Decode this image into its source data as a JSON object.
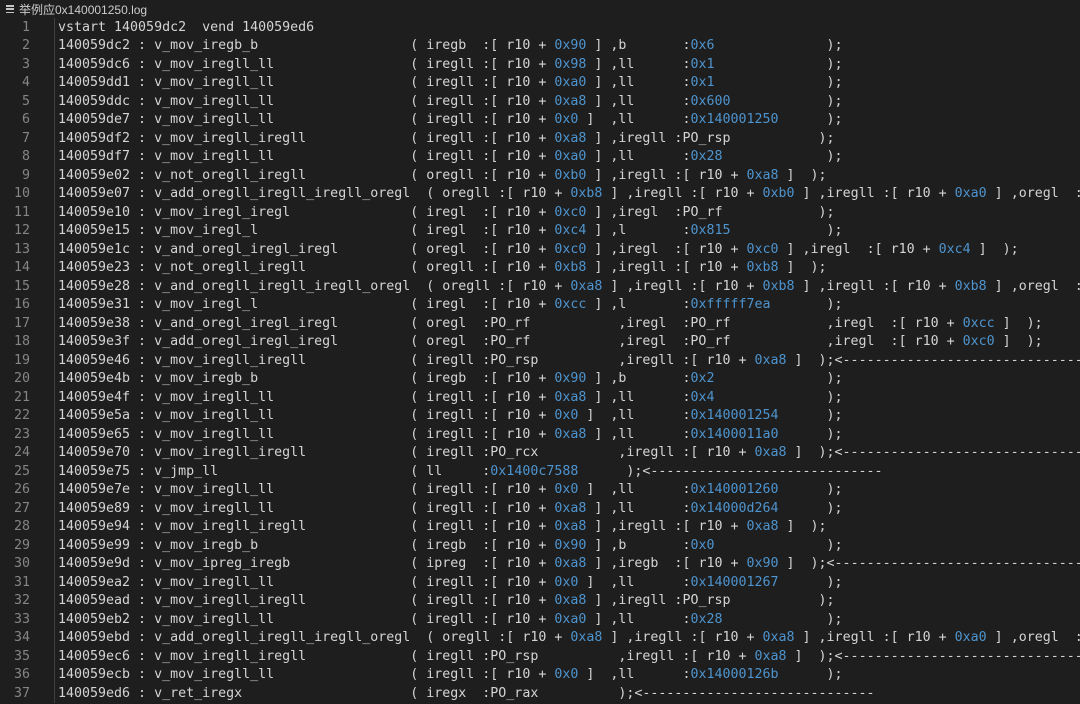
{
  "tab": {
    "title": "举例应0x140001250.log"
  },
  "lines": [
    [
      {
        "t": "vstart 140059dc2  vend 140059ed6"
      }
    ],
    [
      {
        "t": "140059dc2 : v_mov_iregb_b                   ( iregb  :[ r10 + "
      },
      {
        "t": "0x90",
        "h": 1
      },
      {
        "t": " ] ,b       :"
      },
      {
        "t": "0x6",
        "h": 1
      },
      {
        "t": "              );"
      }
    ],
    [
      {
        "t": "140059dc6 : v_mov_iregll_ll                 ( iregll :[ r10 + "
      },
      {
        "t": "0x98",
        "h": 1
      },
      {
        "t": " ] ,ll      :"
      },
      {
        "t": "0x1",
        "h": 1
      },
      {
        "t": "              );"
      }
    ],
    [
      {
        "t": "140059dd1 : v_mov_iregll_ll                 ( iregll :[ r10 + "
      },
      {
        "t": "0xa0",
        "h": 1
      },
      {
        "t": " ] ,ll      :"
      },
      {
        "t": "0x1",
        "h": 1
      },
      {
        "t": "              );"
      }
    ],
    [
      {
        "t": "140059ddc : v_mov_iregll_ll                 ( iregll :[ r10 + "
      },
      {
        "t": "0xa8",
        "h": 1
      },
      {
        "t": " ] ,ll      :"
      },
      {
        "t": "0x600",
        "h": 1
      },
      {
        "t": "            );"
      }
    ],
    [
      {
        "t": "140059de7 : v_mov_iregll_ll                 ( iregll :[ r10 + "
      },
      {
        "t": "0x0",
        "h": 1
      },
      {
        "t": " ]  ,ll      :"
      },
      {
        "t": "0x140001250",
        "h": 1
      },
      {
        "t": "      );"
      }
    ],
    [
      {
        "t": "140059df2 : v_mov_iregll_iregll             ( iregll :[ r10 + "
      },
      {
        "t": "0xa8",
        "h": 1
      },
      {
        "t": " ] ,iregll :PO_rsp           );"
      }
    ],
    [
      {
        "t": "140059df7 : v_mov_iregll_ll                 ( iregll :[ r10 + "
      },
      {
        "t": "0xa0",
        "h": 1
      },
      {
        "t": " ] ,ll      :"
      },
      {
        "t": "0x28",
        "h": 1
      },
      {
        "t": "             );"
      }
    ],
    [
      {
        "t": "140059e02 : v_not_oregll_iregll             ( oregll :[ r10 + "
      },
      {
        "t": "0xb0",
        "h": 1
      },
      {
        "t": " ] ,iregll :[ r10 + "
      },
      {
        "t": "0xa8",
        "h": 1
      },
      {
        "t": " ]  );"
      }
    ],
    [
      {
        "t": "140059e07 : v_add_oregll_iregll_iregll_oregl  ( oregll :[ r10 + "
      },
      {
        "t": "0xb8",
        "h": 1
      },
      {
        "t": " ] ,iregll :[ r10 + "
      },
      {
        "t": "0xb0",
        "h": 1
      },
      {
        "t": " ] ,iregll :[ r10 + "
      },
      {
        "t": "0xa0",
        "h": 1
      },
      {
        "t": " ] ,oregl  :PO_rf"
      }
    ],
    [
      {
        "t": "140059e10 : v_mov_iregl_iregl               ( iregl  :[ r10 + "
      },
      {
        "t": "0xc0",
        "h": 1
      },
      {
        "t": " ] ,iregl  :PO_rf            );"
      }
    ],
    [
      {
        "t": "140059e15 : v_mov_iregl_l                   ( iregl  :[ r10 + "
      },
      {
        "t": "0xc4",
        "h": 1
      },
      {
        "t": " ] ,l       :"
      },
      {
        "t": "0x815",
        "h": 1
      },
      {
        "t": "            );"
      }
    ],
    [
      {
        "t": "140059e1c : v_and_oregl_iregl_iregl         ( oregl  :[ r10 + "
      },
      {
        "t": "0xc0",
        "h": 1
      },
      {
        "t": " ] ,iregl  :[ r10 + "
      },
      {
        "t": "0xc0",
        "h": 1
      },
      {
        "t": " ] ,iregl  :[ r10 + "
      },
      {
        "t": "0xc4",
        "h": 1
      },
      {
        "t": " ]  );"
      }
    ],
    [
      {
        "t": "140059e23 : v_not_oregll_iregll             ( oregll :[ r10 + "
      },
      {
        "t": "0xb8",
        "h": 1
      },
      {
        "t": " ] ,iregll :[ r10 + "
      },
      {
        "t": "0xb8",
        "h": 1
      },
      {
        "t": " ]  );"
      }
    ],
    [
      {
        "t": "140059e28 : v_and_oregll_iregll_iregll_oregl  ( oregll :[ r10 + "
      },
      {
        "t": "0xa8",
        "h": 1
      },
      {
        "t": " ] ,iregll :[ r10 + "
      },
      {
        "t": "0xb8",
        "h": 1
      },
      {
        "t": " ] ,iregll :[ r10 + "
      },
      {
        "t": "0xb8",
        "h": 1
      },
      {
        "t": " ] ,oregl  :PO_rf"
      }
    ],
    [
      {
        "t": "140059e31 : v_mov_iregl_l                   ( iregl  :[ r10 + "
      },
      {
        "t": "0xcc",
        "h": 1
      },
      {
        "t": " ] ,l       :"
      },
      {
        "t": "0xfffff7ea",
        "h": 1
      },
      {
        "t": "       );"
      }
    ],
    [
      {
        "t": "140059e38 : v_and_oregl_iregl_iregl         ( oregl  :PO_rf           ,iregl  :PO_rf            ,iregl  :[ r10 + "
      },
      {
        "t": "0xcc",
        "h": 1
      },
      {
        "t": " ]  );"
      }
    ],
    [
      {
        "t": "140059e3f : v_add_oregl_iregl_iregl         ( oregl  :PO_rf           ,iregl  :PO_rf            ,iregl  :[ r10 + "
      },
      {
        "t": "0xc0",
        "h": 1
      },
      {
        "t": " ]  );"
      }
    ],
    [
      {
        "t": "140059e46 : v_mov_iregll_iregll             ( iregll :PO_rsp          ,iregll :[ r10 + "
      },
      {
        "t": "0xa8",
        "h": 1
      },
      {
        "t": " ]  );<---------------------------------"
      }
    ],
    [
      {
        "t": "140059e4b : v_mov_iregb_b                   ( iregb  :[ r10 + "
      },
      {
        "t": "0x90",
        "h": 1
      },
      {
        "t": " ] ,b       :"
      },
      {
        "t": "0x2",
        "h": 1
      },
      {
        "t": "              );"
      }
    ],
    [
      {
        "t": "140059e4f : v_mov_iregll_ll                 ( iregll :[ r10 + "
      },
      {
        "t": "0xa8",
        "h": 1
      },
      {
        "t": " ] ,ll      :"
      },
      {
        "t": "0x4",
        "h": 1
      },
      {
        "t": "              );"
      }
    ],
    [
      {
        "t": "140059e5a : v_mov_iregll_ll                 ( iregll :[ r10 + "
      },
      {
        "t": "0x0",
        "h": 1
      },
      {
        "t": " ]  ,ll      :"
      },
      {
        "t": "0x140001254",
        "h": 1
      },
      {
        "t": "      );"
      }
    ],
    [
      {
        "t": "140059e65 : v_mov_iregll_ll                 ( iregll :[ r10 + "
      },
      {
        "t": "0xa8",
        "h": 1
      },
      {
        "t": " ] ,ll      :"
      },
      {
        "t": "0x1400011a0",
        "h": 1
      },
      {
        "t": "      );"
      }
    ],
    [
      {
        "t": "140059e70 : v_mov_iregll_iregll             ( iregll :PO_rcx          ,iregll :[ r10 + "
      },
      {
        "t": "0xa8",
        "h": 1
      },
      {
        "t": " ]  );<---------------------------------"
      }
    ],
    [
      {
        "t": "140059e75 : v_jmp_ll                        ( ll     :"
      },
      {
        "t": "0x1400c7588",
        "h": 1
      },
      {
        "t": "      );<-----------------------------"
      }
    ],
    [
      {
        "t": "140059e7e : v_mov_iregll_ll                 ( iregll :[ r10 + "
      },
      {
        "t": "0x0",
        "h": 1
      },
      {
        "t": " ]  ,ll      :"
      },
      {
        "t": "0x140001260",
        "h": 1
      },
      {
        "t": "      );"
      }
    ],
    [
      {
        "t": "140059e89 : v_mov_iregll_ll                 ( iregll :[ r10 + "
      },
      {
        "t": "0xa8",
        "h": 1
      },
      {
        "t": " ] ,ll      :"
      },
      {
        "t": "0x14000d264",
        "h": 1
      },
      {
        "t": "      );"
      }
    ],
    [
      {
        "t": "140059e94 : v_mov_iregll_iregll             ( iregll :[ r10 + "
      },
      {
        "t": "0xa8",
        "h": 1
      },
      {
        "t": " ] ,iregll :[ r10 + "
      },
      {
        "t": "0xa8",
        "h": 1
      },
      {
        "t": " ]  );"
      }
    ],
    [
      {
        "t": "140059e99 : v_mov_iregb_b                   ( iregb  :[ r10 + "
      },
      {
        "t": "0x90",
        "h": 1
      },
      {
        "t": " ] ,b       :"
      },
      {
        "t": "0x0",
        "h": 1
      },
      {
        "t": "              );"
      }
    ],
    [
      {
        "t": "140059e9d : v_mov_ipreg_iregb               ( ipreg  :[ r10 + "
      },
      {
        "t": "0xa8",
        "h": 1
      },
      {
        "t": " ] ,iregb  :[ r10 + "
      },
      {
        "t": "0x90",
        "h": 1
      },
      {
        "t": " ]  );<---------------------------------"
      }
    ],
    [
      {
        "t": "140059ea2 : v_mov_iregll_ll                 ( iregll :[ r10 + "
      },
      {
        "t": "0x0",
        "h": 1
      },
      {
        "t": " ]  ,ll      :"
      },
      {
        "t": "0x140001267",
        "h": 1
      },
      {
        "t": "      );"
      }
    ],
    [
      {
        "t": "140059ead : v_mov_iregll_iregll             ( iregll :[ r10 + "
      },
      {
        "t": "0xa8",
        "h": 1
      },
      {
        "t": " ] ,iregll :PO_rsp           );"
      }
    ],
    [
      {
        "t": "140059eb2 : v_mov_iregll_ll                 ( iregll :[ r10 + "
      },
      {
        "t": "0xa0",
        "h": 1
      },
      {
        "t": " ] ,ll      :"
      },
      {
        "t": "0x28",
        "h": 1
      },
      {
        "t": "             );"
      }
    ],
    [
      {
        "t": "140059ebd : v_add_oregll_iregll_iregll_oregl  ( oregll :[ r10 + "
      },
      {
        "t": "0xa8",
        "h": 1
      },
      {
        "t": " ] ,iregll :[ r10 + "
      },
      {
        "t": "0xa8",
        "h": 1
      },
      {
        "t": " ] ,iregll :[ r10 + "
      },
      {
        "t": "0xa0",
        "h": 1
      },
      {
        "t": " ] ,oregl  :PO_rf"
      }
    ],
    [
      {
        "t": "140059ec6 : v_mov_iregll_iregll             ( iregll :PO_rsp          ,iregll :[ r10 + "
      },
      {
        "t": "0xa8",
        "h": 1
      },
      {
        "t": " ]  );<---------------------------------"
      }
    ],
    [
      {
        "t": "140059ecb : v_mov_iregll_ll                 ( iregll :[ r10 + "
      },
      {
        "t": "0x0",
        "h": 1
      },
      {
        "t": " ]  ,ll      :"
      },
      {
        "t": "0x14000126b",
        "h": 1
      },
      {
        "t": "      );"
      }
    ],
    [
      {
        "t": "140059ed6 : v_ret_iregx                     ( iregx  :PO_rax          );<-----------------------------"
      }
    ]
  ]
}
